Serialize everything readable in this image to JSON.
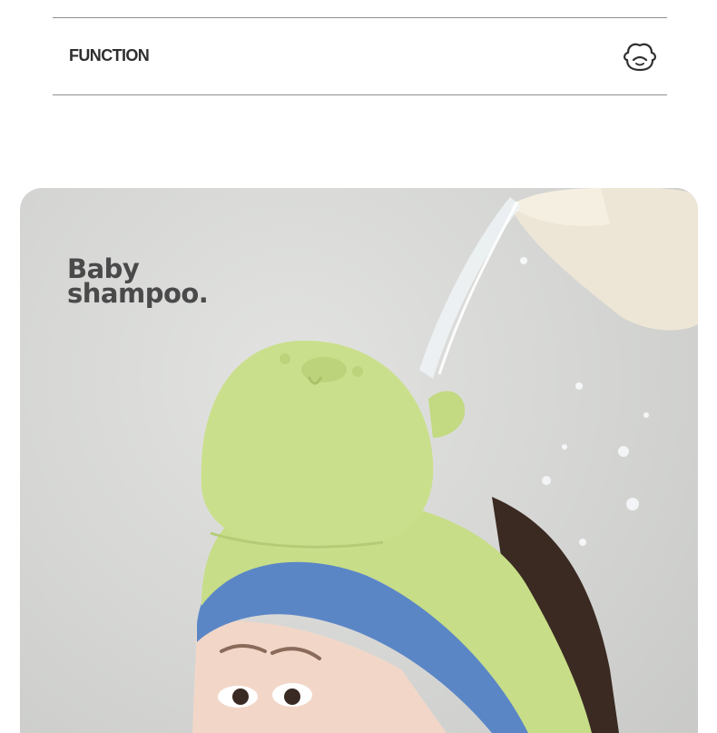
{
  "header": {
    "title": "FUNCTION",
    "icon": "cute-face-icon"
  },
  "hero": {
    "headline_line1": "Baby",
    "headline_line2": "shampoo.",
    "image": "baby-wearing-green-bear-shampoo-cap"
  },
  "colors": {
    "cap_green": "#c7dd87",
    "cap_band_blue": "#5b86c6",
    "background_gray": "#d6d7d5",
    "text_dark": "#2f2f2f"
  }
}
